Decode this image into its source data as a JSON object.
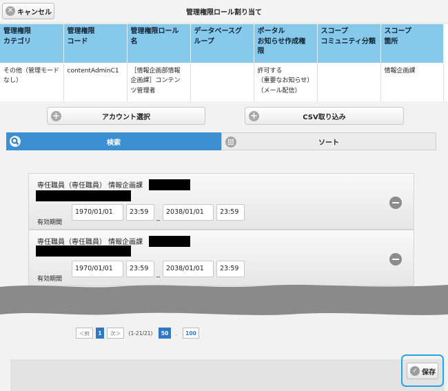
{
  "header": {
    "cancel_label": "キャンセル",
    "title": "管理権限ロール割り当て"
  },
  "table": {
    "headers": [
      "管理権限\nカテゴリ",
      "管理権限\nコード",
      "管理権限ロール\n名",
      "データベースグ\nループ",
      "ポータル\nお知らせ作成権\n限",
      "スコープ\nコミュニティ分類",
      "スコープ\n箇所"
    ],
    "row": [
      "その他（管理モード\nなし）",
      "contentAdminC1",
      "［情報企画部情報\n企画課］コンテン\nツ管理者",
      "",
      "許可する\n（重要なお知らせ）\n（メール配信）",
      "",
      "情報企画課"
    ]
  },
  "actions": {
    "account_select": "アカウント選択",
    "csv_import": "CSV取り込み"
  },
  "tabs": {
    "search": "検索",
    "sort": "ソート"
  },
  "entries": [
    {
      "name": "専任職員（専任職員） 情報企画課",
      "validity_label": "有効期間",
      "start_date": "1970/01/01",
      "start_time": "23:59",
      "separator": "_",
      "end_date": "2038/01/01",
      "end_time": "23:59"
    },
    {
      "name": "専任職員（専任職員） 情報企画課",
      "validity_label": "有効期間",
      "start_date": "1970/01/01",
      "start_time": "23:59",
      "separator": "_",
      "end_date": "2038/01/01",
      "end_time": "23:59"
    }
  ],
  "pagination": {
    "prev": "＜前",
    "current": "1",
    "next": "次＞",
    "range": "(1-21/21)",
    "size_50": "50",
    "dot": ".",
    "size_100": "100"
  },
  "footer": {
    "save_label": "保存"
  },
  "colors": {
    "header_blue": "#87c9ea",
    "tab_active": "#3c8fd3",
    "focus_ring": "#27a6dd"
  }
}
